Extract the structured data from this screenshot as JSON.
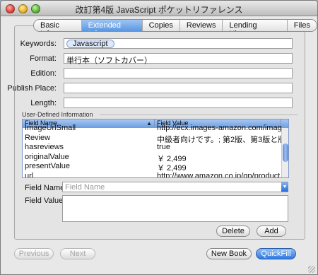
{
  "window": {
    "title": "改訂第4版 JavaScript ポケットリファレンス"
  },
  "tabs": [
    {
      "label": "Basic Info.",
      "active": false
    },
    {
      "label": "Extended Info.",
      "active": true
    },
    {
      "label": "Copies",
      "active": false
    },
    {
      "label": "Reviews",
      "active": false
    },
    {
      "label": "Lending History",
      "active": false
    },
    {
      "label": "Files",
      "active": false
    }
  ],
  "form": {
    "keywords_label": "Keywords:",
    "keywords_token": "Javascript",
    "format_label": "Format:",
    "format_value": "単行本（ソフトカバー）",
    "edition_label": "Edition:",
    "edition_value": "",
    "publish_place_label": "Publish Place:",
    "publish_place_value": "",
    "length_label": "Length:",
    "length_value": ""
  },
  "user_defined": {
    "section_label": "User-Defined Information",
    "columns": [
      "Field Name",
      "Field Value"
    ],
    "rows": [
      {
        "name": "ImageUrlSmall",
        "value": "http://ecx.images-amazon.com/imag..."
      },
      {
        "name": "Review",
        "value": "中級者向けです。; 第2版、第3版と版を..."
      },
      {
        "name": "hasreviews",
        "value": "true"
      },
      {
        "name": "originalValue",
        "value": "￥ 2,499"
      },
      {
        "name": "presentValue",
        "value": "￥ 2,499"
      },
      {
        "name": "url",
        "value": "http://www.amazon.co.jp/gp/product..."
      }
    ],
    "field_name_label": "Field Name:",
    "field_name_placeholder": "Field Name",
    "field_value_label": "Field Value:",
    "field_value": ""
  },
  "buttons": {
    "delete": "Delete",
    "add": "Add",
    "previous": "Previous",
    "next": "Next",
    "new_book": "New Book",
    "quickfill": "QuickFill"
  },
  "colors": {
    "accent": "#5b97e3",
    "primary_button": "#2f78e0"
  }
}
